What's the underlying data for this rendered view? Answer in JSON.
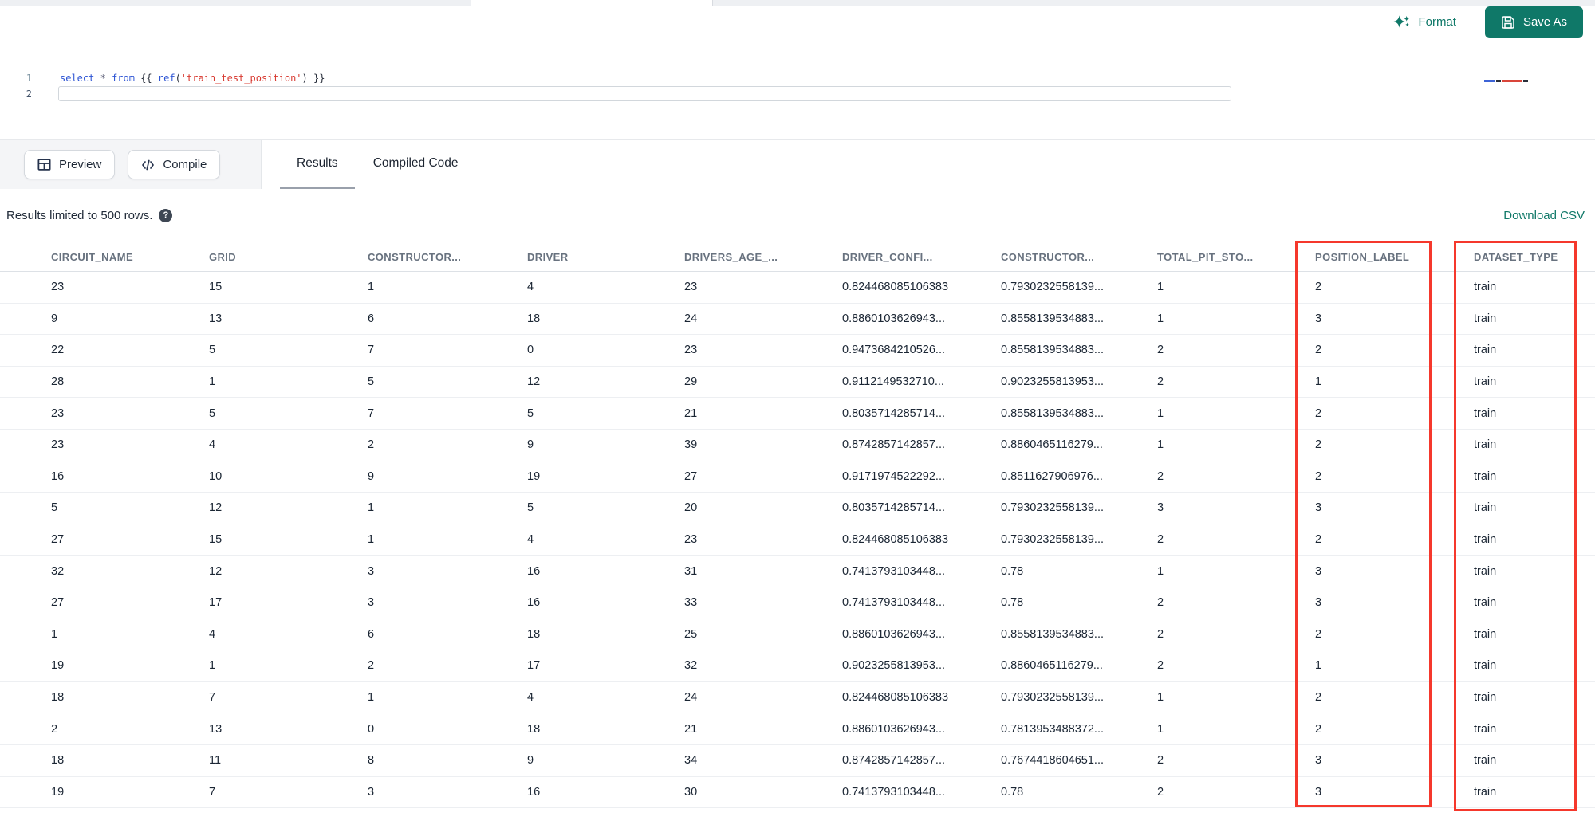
{
  "colors": {
    "accent_teal": "#0f7868",
    "highlight_red": "#f5382c"
  },
  "top_toolbar": {
    "format_label": "Format",
    "save_as_label": "Save As"
  },
  "editor": {
    "line_numbers": [
      "1",
      "2"
    ],
    "code_line": "select * from {{ ref('train_test_position') }}",
    "tokens": [
      {
        "t": "select",
        "c": "kw"
      },
      {
        "t": " ",
        "c": "plain"
      },
      {
        "t": "*",
        "c": "star"
      },
      {
        "t": " ",
        "c": "plain"
      },
      {
        "t": "from",
        "c": "kw"
      },
      {
        "t": " {{ ",
        "c": "plain"
      },
      {
        "t": "ref",
        "c": "fn"
      },
      {
        "t": "(",
        "c": "plain"
      },
      {
        "t": "'train_test_position'",
        "c": "str"
      },
      {
        "t": ")",
        "c": "plain"
      },
      {
        "t": " }}",
        "c": "plain"
      }
    ]
  },
  "actions": {
    "preview_label": "Preview",
    "compile_label": "Compile"
  },
  "tabs": [
    {
      "label": "Results",
      "active": true
    },
    {
      "label": "Compiled Code",
      "active": false
    }
  ],
  "results_bar": {
    "limit_text": "Results limited to 500 rows.",
    "help_glyph": "?",
    "download_label": "Download CSV"
  },
  "table": {
    "columns": [
      "CIRCUIT_NAME",
      "GRID",
      "CONSTRUCTOR...",
      "DRIVER",
      "DRIVERS_AGE_...",
      "DRIVER_CONFI...",
      "CONSTRUCTOR...",
      "TOTAL_PIT_STO...",
      "POSITION_LABEL",
      "DATASET_TYPE"
    ],
    "highlighted_columns": [
      "POSITION_LABEL",
      "DATASET_TYPE"
    ],
    "rows": [
      [
        "23",
        "15",
        "1",
        "4",
        "23",
        "0.824468085106383",
        "0.7930232558139...",
        "1",
        "2",
        "train"
      ],
      [
        "9",
        "13",
        "6",
        "18",
        "24",
        "0.8860103626943...",
        "0.8558139534883...",
        "1",
        "3",
        "train"
      ],
      [
        "22",
        "5",
        "7",
        "0",
        "23",
        "0.9473684210526...",
        "0.8558139534883...",
        "2",
        "2",
        "train"
      ],
      [
        "28",
        "1",
        "5",
        "12",
        "29",
        "0.9112149532710...",
        "0.9023255813953...",
        "2",
        "1",
        "train"
      ],
      [
        "23",
        "5",
        "7",
        "5",
        "21",
        "0.8035714285714...",
        "0.8558139534883...",
        "1",
        "2",
        "train"
      ],
      [
        "23",
        "4",
        "2",
        "9",
        "39",
        "0.8742857142857...",
        "0.8860465116279...",
        "1",
        "2",
        "train"
      ],
      [
        "16",
        "10",
        "9",
        "19",
        "27",
        "0.9171974522292...",
        "0.8511627906976...",
        "2",
        "2",
        "train"
      ],
      [
        "5",
        "12",
        "1",
        "5",
        "20",
        "0.8035714285714...",
        "0.7930232558139...",
        "3",
        "3",
        "train"
      ],
      [
        "27",
        "15",
        "1",
        "4",
        "23",
        "0.824468085106383",
        "0.7930232558139...",
        "2",
        "2",
        "train"
      ],
      [
        "32",
        "12",
        "3",
        "16",
        "31",
        "0.7413793103448...",
        "0.78",
        "1",
        "3",
        "train"
      ],
      [
        "27",
        "17",
        "3",
        "16",
        "33",
        "0.7413793103448...",
        "0.78",
        "2",
        "3",
        "train"
      ],
      [
        "1",
        "4",
        "6",
        "18",
        "25",
        "0.8860103626943...",
        "0.8558139534883...",
        "2",
        "2",
        "train"
      ],
      [
        "19",
        "1",
        "2",
        "17",
        "32",
        "0.9023255813953...",
        "0.8860465116279...",
        "2",
        "1",
        "train"
      ],
      [
        "18",
        "7",
        "1",
        "4",
        "24",
        "0.824468085106383",
        "0.7930232558139...",
        "1",
        "2",
        "train"
      ],
      [
        "2",
        "13",
        "0",
        "18",
        "21",
        "0.8860103626943...",
        "0.7813953488372...",
        "1",
        "2",
        "train"
      ],
      [
        "18",
        "11",
        "8",
        "9",
        "34",
        "0.8742857142857...",
        "0.7674418604651...",
        "2",
        "3",
        "train"
      ],
      [
        "19",
        "7",
        "3",
        "16",
        "30",
        "0.7413793103448...",
        "0.78",
        "2",
        "3",
        "train"
      ]
    ]
  }
}
